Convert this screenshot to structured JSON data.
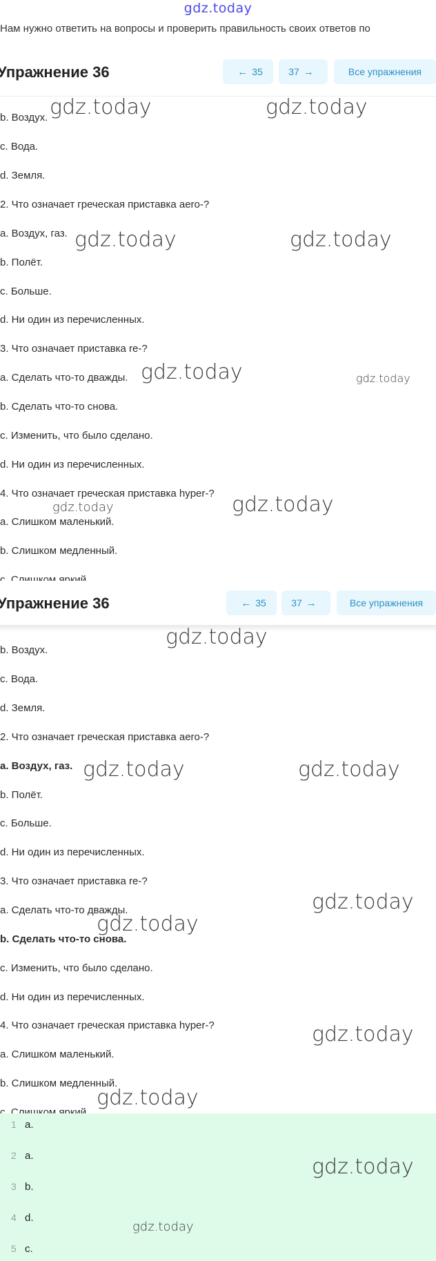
{
  "watermark_top": "gdz.today",
  "intro": "Нам нужно ответить на вопросы и проверить правильность своих ответов по",
  "exercise": {
    "title": "Упражнение 36",
    "prev_label": "35",
    "next_label": "37",
    "all_label": "Все упражнения"
  },
  "lines": [
    "b. Воздух.",
    "c. Вода.",
    "d. Земля.",
    "2. Что означает греческая приставка aero-?",
    "a. Воздух, газ.",
    "b. Полёт.",
    "c. Больше.",
    "d. Ни один из перечисленных.",
    "3. Что означает приставка re-?",
    "a. Сделать что-то дважды.",
    "b. Сделать что-то снова.",
    "c. Изменить, что было сделано.",
    "d. Ни один из перечисленных.",
    "4. Что означает греческая приставка hyper-?",
    "a. Слишком маленький.",
    "b. Слишком медленный.",
    "c. Слишком яркий."
  ],
  "watermark": "gdz.today",
  "answers": [
    {
      "num": "1",
      "val": "a."
    },
    {
      "num": "2",
      "val": "a."
    },
    {
      "num": "3",
      "val": "b."
    },
    {
      "num": "4",
      "val": "d."
    },
    {
      "num": "5",
      "val": "c."
    }
  ],
  "colors": {
    "accent": "#2f8fc4",
    "button_bg": "#e7f7fd",
    "answers_bg": "#ddfbe8"
  }
}
